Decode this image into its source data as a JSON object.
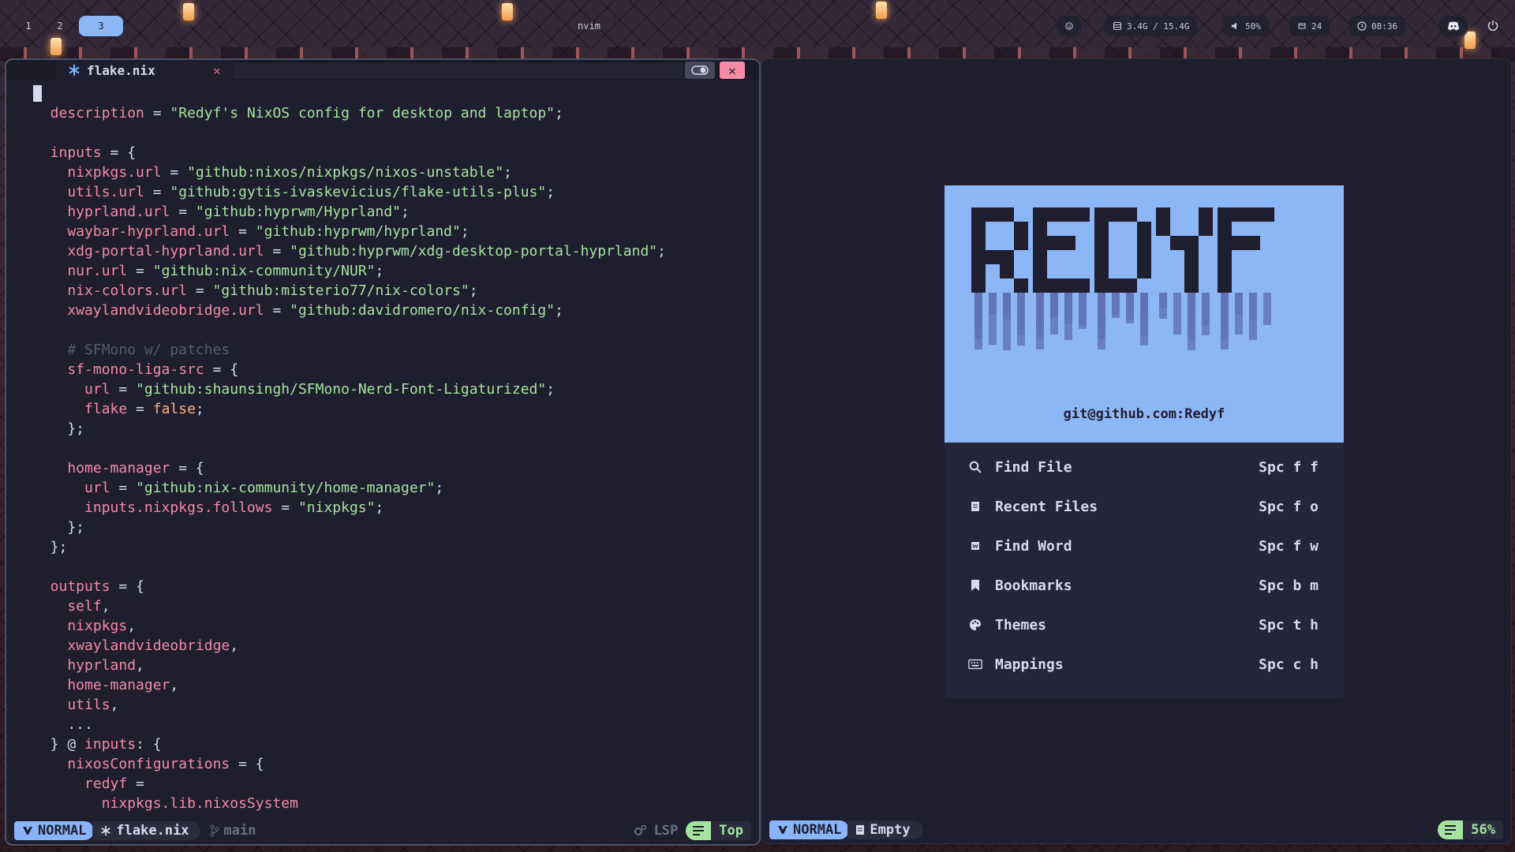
{
  "topbar": {
    "workspaces": [
      "1",
      "2",
      "3"
    ],
    "active_workspace": "3",
    "window_title": "nvim",
    "memory": "3.4G / 15.4G",
    "volume": "50%",
    "updates": "24",
    "clock": "08:36"
  },
  "left": {
    "tab_filename": "flake.nix",
    "code_lines": [
      [
        [
          "p",
          "{"
        ]
      ],
      [
        [
          "k",
          "  description"
        ],
        [
          "p",
          " = "
        ],
        [
          "s",
          "\"Redyf's NixOS config for desktop and laptop\""
        ],
        [
          "p",
          ";"
        ]
      ],
      [
        [
          "p",
          ""
        ]
      ],
      [
        [
          "k",
          "  inputs"
        ],
        [
          "p",
          " = {"
        ]
      ],
      [
        [
          "k",
          "    nixpkgs.url"
        ],
        [
          "p",
          " = "
        ],
        [
          "s",
          "\"github:nixos/nixpkgs/nixos-unstable\""
        ],
        [
          "p",
          ";"
        ]
      ],
      [
        [
          "k",
          "    utils.url"
        ],
        [
          "p",
          " = "
        ],
        [
          "s",
          "\"github:gytis-ivaskevicius/flake-utils-plus\""
        ],
        [
          "p",
          ";"
        ]
      ],
      [
        [
          "k",
          "    hyprland.url"
        ],
        [
          "p",
          " = "
        ],
        [
          "s",
          "\"github:hyprwm/Hyprland\""
        ],
        [
          "p",
          ";"
        ]
      ],
      [
        [
          "k",
          "    waybar-hyprland.url"
        ],
        [
          "p",
          " = "
        ],
        [
          "s",
          "\"github:hyprwm/hyprland\""
        ],
        [
          "p",
          ";"
        ]
      ],
      [
        [
          "k",
          "    xdg-portal-hyprland.url"
        ],
        [
          "p",
          " = "
        ],
        [
          "s",
          "\"github:hyprwm/xdg-desktop-portal-hyprland\""
        ],
        [
          "p",
          ";"
        ]
      ],
      [
        [
          "k",
          "    nur.url"
        ],
        [
          "p",
          " = "
        ],
        [
          "s",
          "\"github:nix-community/NUR\""
        ],
        [
          "p",
          ";"
        ]
      ],
      [
        [
          "k",
          "    nix-colors.url"
        ],
        [
          "p",
          " = "
        ],
        [
          "s",
          "\"github:misterio77/nix-colors\""
        ],
        [
          "p",
          ";"
        ]
      ],
      [
        [
          "k",
          "    xwaylandvideobridge.url"
        ],
        [
          "p",
          " = "
        ],
        [
          "s",
          "\"github:davidromero/nix-config\""
        ],
        [
          "p",
          ";"
        ]
      ],
      [
        [
          "p",
          ""
        ]
      ],
      [
        [
          "c",
          "    # SFMono w/ patches"
        ]
      ],
      [
        [
          "k",
          "    sf-mono-liga-src"
        ],
        [
          "p",
          " = {"
        ]
      ],
      [
        [
          "k",
          "      url"
        ],
        [
          "p",
          " = "
        ],
        [
          "s",
          "\"github:shaunsingh/SFMono-Nerd-Font-Ligaturized\""
        ],
        [
          "p",
          ";"
        ]
      ],
      [
        [
          "k",
          "      flake"
        ],
        [
          "p",
          " = "
        ],
        [
          "b",
          "false"
        ],
        [
          "p",
          ";"
        ]
      ],
      [
        [
          "p",
          "    };"
        ]
      ],
      [
        [
          "p",
          ""
        ]
      ],
      [
        [
          "k",
          "    home-manager"
        ],
        [
          "p",
          " = {"
        ]
      ],
      [
        [
          "k",
          "      url"
        ],
        [
          "p",
          " = "
        ],
        [
          "s",
          "\"github:nix-community/home-manager\""
        ],
        [
          "p",
          ";"
        ]
      ],
      [
        [
          "k",
          "      inputs.nixpkgs.follows"
        ],
        [
          "p",
          " = "
        ],
        [
          "s",
          "\"nixpkgs\""
        ],
        [
          "p",
          ";"
        ]
      ],
      [
        [
          "p",
          "    };"
        ]
      ],
      [
        [
          "p",
          "  };"
        ]
      ],
      [
        [
          "p",
          ""
        ]
      ],
      [
        [
          "k",
          "  outputs"
        ],
        [
          "p",
          " = {"
        ]
      ],
      [
        [
          "k",
          "    self"
        ],
        [
          "p",
          ","
        ]
      ],
      [
        [
          "k",
          "    nixpkgs"
        ],
        [
          "p",
          ","
        ]
      ],
      [
        [
          "k",
          "    xwaylandvideobridge"
        ],
        [
          "p",
          ","
        ]
      ],
      [
        [
          "k",
          "    hyprland"
        ],
        [
          "p",
          ","
        ]
      ],
      [
        [
          "k",
          "    home-manager"
        ],
        [
          "p",
          ","
        ]
      ],
      [
        [
          "k",
          "    utils"
        ],
        [
          "p",
          ","
        ]
      ],
      [
        [
          "p",
          "    ..."
        ]
      ],
      [
        [
          "p",
          "  } @ "
        ],
        [
          "k",
          "inputs"
        ],
        [
          "p",
          ": {"
        ]
      ],
      [
        [
          "k",
          "    nixosConfigurations"
        ],
        [
          "p",
          " = {"
        ]
      ],
      [
        [
          "k",
          "      redyf"
        ],
        [
          "p",
          " ="
        ]
      ],
      [
        [
          "k",
          "        nixpkgs.lib.nixosSystem"
        ]
      ]
    ],
    "status": {
      "mode": "NORMAL",
      "file": "flake.nix",
      "branch": "main",
      "lsp": "LSP",
      "position": "Top"
    }
  },
  "right": {
    "git_url": "git@github.com:Redyf",
    "menu": [
      {
        "icon": "search-icon",
        "label": "Find File",
        "key": "Spc f f"
      },
      {
        "icon": "file-icon",
        "label": "Recent Files",
        "key": "Spc f o"
      },
      {
        "icon": "word-icon",
        "label": "Find Word",
        "key": "Spc f w"
      },
      {
        "icon": "bookmark-icon",
        "label": "Bookmarks",
        "key": "Spc b m"
      },
      {
        "icon": "palette-icon",
        "label": "Themes",
        "key": "Spc t h"
      },
      {
        "icon": "keyboard-icon",
        "label": "Mappings",
        "key": "Spc c h"
      }
    ],
    "status": {
      "mode": "NORMAL",
      "buffer": "Empty",
      "position": "56%"
    }
  },
  "colors": {
    "accent_blue": "#89b4fa",
    "accent_pink": "#f38ba8",
    "accent_green": "#a6e3a1",
    "background": "#1e1e2e"
  }
}
